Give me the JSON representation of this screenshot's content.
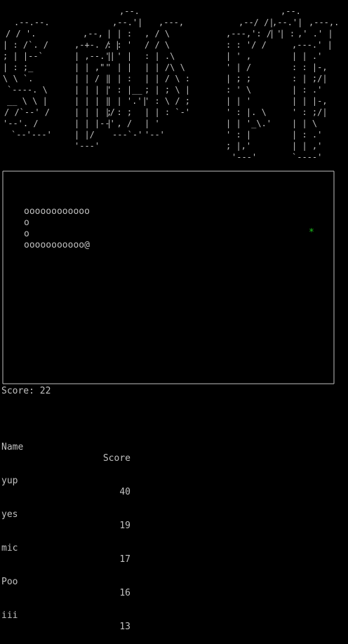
{
  "banner": {
    "art": "  .--.--.    ,-.    ,-.   ,--.    ,-.  ,----.  \n /  /    '. | | |  | |  /  /| ,-|  | |  |   ,  \\ \n|  :  /`. / | | |  | | ,--, | '--|  | |  |  |  .\\ :\n;  |  |--`  | |/ | /  | | |  | :  | | |   |  |  |  '\n|  :  ;_    |   ,  |   ' | |  | |   ' :  |  |  |  :\n \\  \\    `. |  /|  | |  |  |  : '  |  |  '  :  |  | ;\n  `----.   \\| |  \\ | |  |  '  | |  | |   |  |  |  '\n  __ \\  \\  || |   \\| |  | _|  : ;  : |   |  :  |  |\n /  /`--'  /| |   | |  |   \\  ;  |  :  |  '  :  |  ;\n'--'.     / | |   | |  '    \\ |  ;  :  ;  |  |  |  '\n  `--'---'  `-'   `-'   `----' `-'  `--'  `--'--'  "
  },
  "game": {
    "board": {
      "rows": [
        "oooooooooooo",
        "o",
        "o",
        "ooooooooooo@"
      ],
      "food": "*"
    },
    "score_label": "Score:",
    "score_value": "22"
  },
  "highscores": {
    "header_name": "Name",
    "header_score": "Score",
    "entries": [
      {
        "name": "yup",
        "score": "40"
      },
      {
        "name": "yes",
        "score": "19"
      },
      {
        "name": "mic",
        "score": "17"
      },
      {
        "name": "Poo",
        "score": "16"
      },
      {
        "name": "iii",
        "score": "13"
      }
    ]
  },
  "colors": {
    "background": "#000000",
    "text": "#c0c0c0",
    "food": "#1ec31e"
  }
}
